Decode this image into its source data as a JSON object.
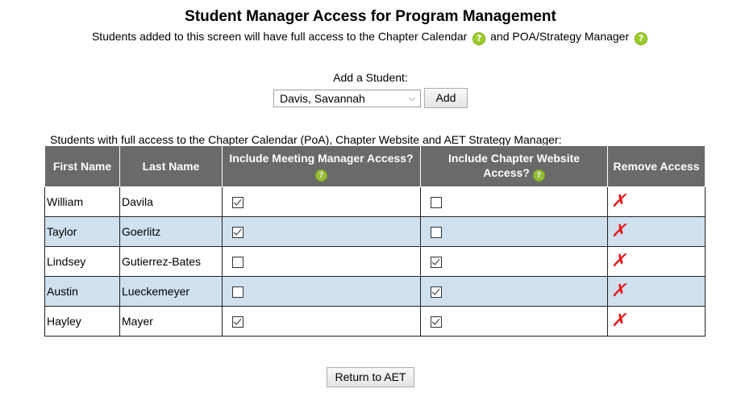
{
  "header": {
    "title": "Student Manager Access for Program Management",
    "subtitle_part1": "Students added to this screen will have full access to the Chapter Calendar",
    "subtitle_part2": "and POA/Strategy Manager",
    "help_glyph": "?"
  },
  "add_student": {
    "label": "Add a Student:",
    "selected": "Davis, Savannah",
    "chevron": "⌵",
    "add_button": "Add"
  },
  "table": {
    "caption": "Students with full access to the Chapter Calendar (PoA), Chapter Website and AET Strategy Manager:",
    "headers": {
      "first_name": "First Name",
      "last_name": "Last Name",
      "meeting_manager": "Include Meeting Manager Access?",
      "chapter_website": "Include Chapter Website Access?",
      "remove": "Remove Access"
    },
    "remove_glyph": "✗",
    "rows": [
      {
        "first": "William",
        "last": "Davila",
        "meeting_manager": true,
        "chapter_website": false
      },
      {
        "first": "Taylor",
        "last": "Goerlitz",
        "meeting_manager": true,
        "chapter_website": false
      },
      {
        "first": "Lindsey",
        "last": "Gutierrez-Bates",
        "meeting_manager": false,
        "chapter_website": true
      },
      {
        "first": "Austin",
        "last": "Lueckemeyer",
        "meeting_manager": false,
        "chapter_website": true
      },
      {
        "first": "Hayley",
        "last": "Mayer",
        "meeting_manager": true,
        "chapter_website": true
      }
    ]
  },
  "footer": {
    "return_button": "Return to AET"
  },
  "colors": {
    "header_bg": "#6a6a6a",
    "alt_row_bg": "#cfe0ee",
    "remove_color": "#ee1111",
    "help_icon": "#9ccc2a"
  }
}
